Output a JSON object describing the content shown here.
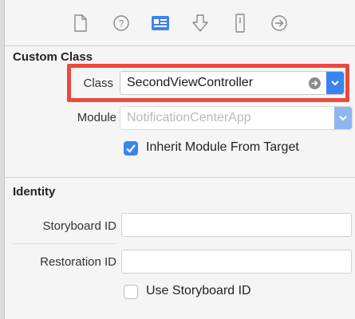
{
  "toolbar": {
    "icons": [
      "file-icon",
      "help-icon",
      "identity-icon",
      "attributes-icon",
      "size-icon",
      "connections-icon"
    ]
  },
  "custom_class": {
    "title": "Custom Class",
    "class_label": "Class",
    "class_value": "SecondViewController",
    "module_label": "Module",
    "module_placeholder": "NotificationCenterApp",
    "inherit_label": "Inherit Module From Target",
    "inherit_checked": true
  },
  "identity": {
    "title": "Identity",
    "storyboard_id_label": "Storyboard ID",
    "storyboard_id_value": "",
    "restoration_id_label": "Restoration ID",
    "restoration_id_value": "",
    "use_storyboard_id_label": "Use Storyboard ID",
    "use_storyboard_id_checked": false
  },
  "colors": {
    "accent": "#3a84f0",
    "highlight": "#e84a3f"
  }
}
